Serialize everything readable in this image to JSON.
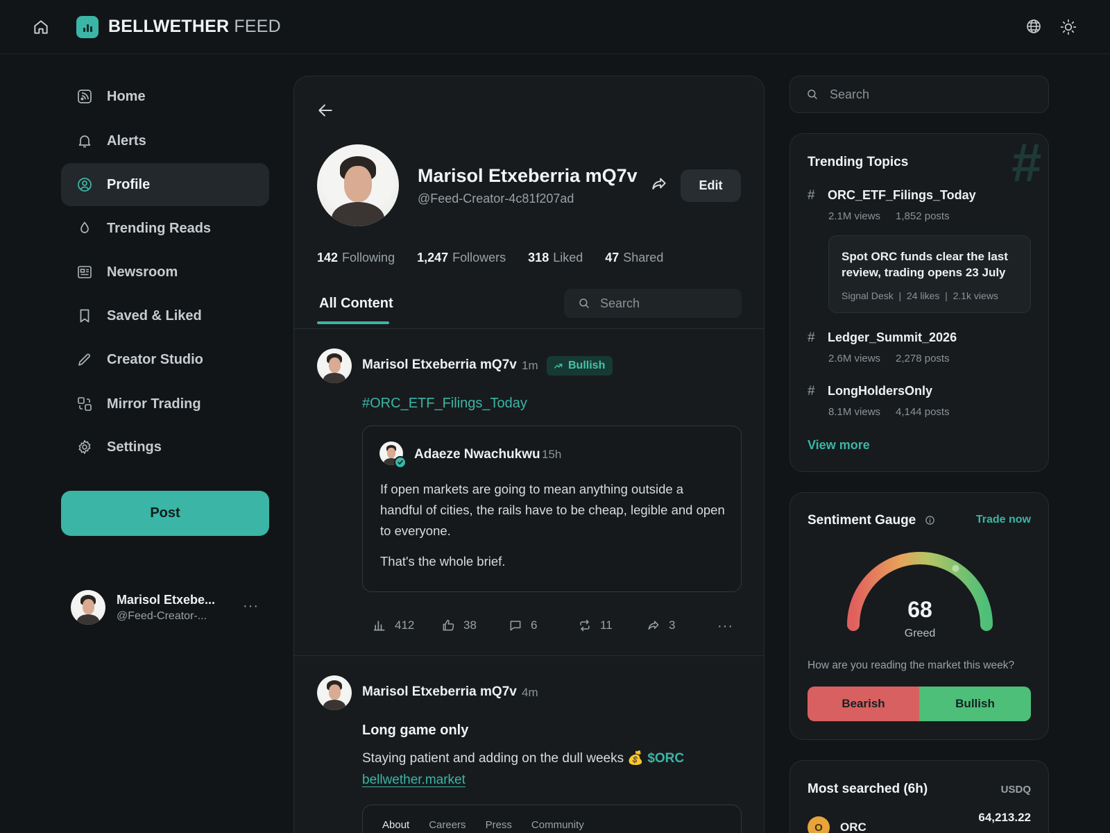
{
  "brand": {
    "name_bold": "BELLWETHER",
    "name_light": "FEED",
    "accent": "#3bb5a6"
  },
  "topbar": {
    "icons": [
      "home-icon",
      "globe-icon",
      "sun-icon"
    ]
  },
  "sidebar": {
    "items": [
      {
        "label": "Home",
        "icon": "rss-icon"
      },
      {
        "label": "Alerts",
        "icon": "bell-icon"
      },
      {
        "label": "Profile",
        "icon": "user-circle-icon",
        "active": true
      },
      {
        "label": "Trending Reads",
        "icon": "flame-icon"
      },
      {
        "label": "Newsroom",
        "icon": "newspaper-icon"
      },
      {
        "label": "Saved & Liked",
        "icon": "bookmark-icon"
      },
      {
        "label": "Creator Studio",
        "icon": "pencil-icon"
      },
      {
        "label": "Mirror Trading",
        "icon": "mirror-trading-icon"
      },
      {
        "label": "Settings",
        "icon": "gear-icon"
      }
    ],
    "post_label": "Post",
    "me": {
      "name": "Marisol Etxebe...",
      "handle": "@Feed-Creator-..."
    }
  },
  "profile": {
    "name": "Marisol Etxeberria mQ7v",
    "handle": "@Feed-Creator-4c81f207ad",
    "edit_label": "Edit",
    "stats": [
      {
        "value": "142",
        "label": "Following"
      },
      {
        "value": "1,247",
        "label": "Followers"
      },
      {
        "value": "318",
        "label": "Liked"
      },
      {
        "value": "47",
        "label": "Shared"
      }
    ],
    "tab": "All Content",
    "search_placeholder": "Search"
  },
  "posts": [
    {
      "author": "Marisol Etxeberria mQ7v",
      "time": "1m",
      "badge": "Bullish",
      "hashtag": "#ORC_ETF_Filings_Today",
      "quote": {
        "author": "Adaeze Nwachukwu",
        "time": "15h",
        "text": "If open markets are going to mean anything outside a handful of cities, the rails have to be cheap, legible and open to everyone.",
        "text2": "That's the whole brief."
      },
      "actions": {
        "views": "412",
        "likes": "38",
        "comments": "6",
        "reposts": "11",
        "shares": "3"
      }
    },
    {
      "author": "Marisol Etxeberria mQ7v",
      "time": "4m",
      "title": "Long game only",
      "text": "Staying patient and adding on the dull weeks 💰",
      "cashtag": "$ORC",
      "link": "bellwether.market",
      "link_nav": [
        "About",
        "Careers",
        "Press",
        "Community"
      ]
    }
  ],
  "right": {
    "search_placeholder": "Search",
    "trending": {
      "title": "Trending Topics",
      "topics": [
        {
          "name": "ORC_ETF_Filings_Today",
          "views": "2.1M views",
          "posts": "1,852 posts"
        },
        {
          "name": "Ledger_Summit_2026",
          "views": "2.6M views",
          "posts": "2,278 posts"
        },
        {
          "name": "LongHoldersOnly",
          "views": "8.1M views",
          "posts": "4,144 posts"
        }
      ],
      "news": {
        "title": "Spot ORC funds clear the last review, trading opens 23 July",
        "source": "Signal Desk",
        "likes": "24 likes",
        "views": "2.1k views"
      },
      "view_more": "View more"
    },
    "sentiment": {
      "title": "Sentiment Gauge",
      "trade_now": "Trade now",
      "value": 68,
      "value_text": "68",
      "label": "Greed",
      "question": "How are you reading the market this week?",
      "bearish": "Bearish",
      "bullish": "Bullish",
      "bear_color": "#d96060",
      "bull_color": "#4dbf78"
    },
    "most_searched": {
      "title": "Most searched (6h)",
      "currency": "USDQ",
      "rows": [
        {
          "symbol_letter": "O",
          "name": "ORC",
          "price": "64,213.22"
        }
      ]
    }
  }
}
